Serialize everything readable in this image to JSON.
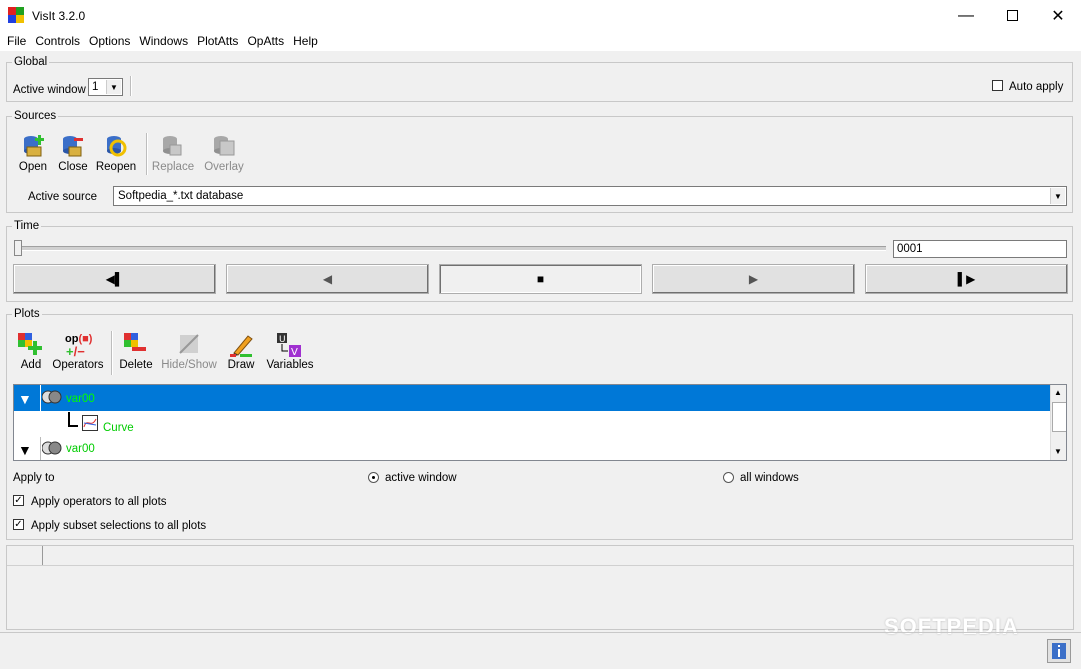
{
  "window": {
    "title": "VisIt 3.2.0"
  },
  "menu": [
    "File",
    "Controls",
    "Options",
    "Windows",
    "PlotAtts",
    "OpAtts",
    "Help"
  ],
  "global": {
    "title": "Global",
    "active_window_label": "Active window",
    "active_window_value": "1",
    "auto_apply_label": "Auto apply"
  },
  "sources": {
    "title": "Sources",
    "buttons": {
      "open": "Open",
      "close": "Close",
      "reopen": "Reopen",
      "replace": "Replace",
      "overlay": "Overlay"
    },
    "active_source_label": "Active source",
    "active_source_value": "Softpedia_*.txt database"
  },
  "time": {
    "title": "Time",
    "frame_value": "0001",
    "slider_fraction": 0.0
  },
  "plots": {
    "title": "Plots",
    "buttons": {
      "add": "Add",
      "operators": "Operators",
      "delete": "Delete",
      "hide_show": "Hide/Show",
      "draw": "Draw",
      "variables": "Variables"
    },
    "operators_icon_text": "op",
    "list": [
      {
        "label": "var00",
        "selected": true
      },
      {
        "label": "Curve",
        "child": true
      },
      {
        "label": "var00",
        "selected": false
      }
    ],
    "apply_to_label": "Apply to",
    "active_window_option": "active window",
    "all_windows_option": "all windows",
    "apply_operators_label": "Apply operators to all plots",
    "apply_subset_label": "Apply subset selections to all plots"
  },
  "watermark": "SOFTPEDIA",
  "colors": {
    "selection": "#0078d7",
    "plot_text": "#00cc00"
  }
}
